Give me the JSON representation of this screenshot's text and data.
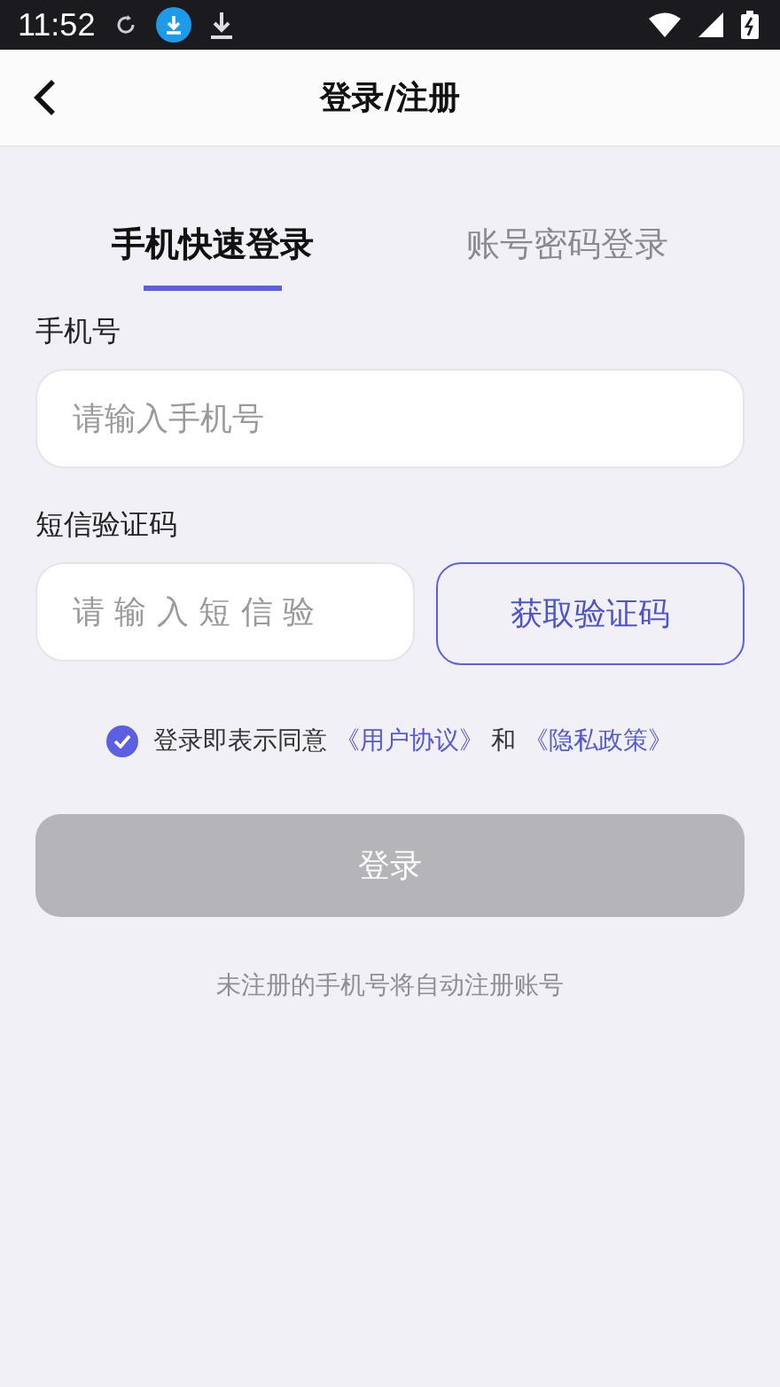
{
  "status_bar": {
    "time": "11:52"
  },
  "header": {
    "title": "登录/注册"
  },
  "tabs": [
    {
      "label": "手机快速登录",
      "selected": true
    },
    {
      "label": "账号密码登录",
      "selected": false
    }
  ],
  "phone": {
    "label": "手机号",
    "placeholder": "请输入手机号"
  },
  "sms": {
    "label": "短信验证码",
    "placeholder": "请 输 入 短 信 验",
    "button": "获取验证码"
  },
  "agreement": {
    "checked": true,
    "text": "登录即表示同意",
    "link_1": "《用户协议》",
    "and": "和",
    "link_2": "《隐私政策》"
  },
  "login_button": {
    "label": "登录",
    "disabled": true
  },
  "note": "未注册的手机号将自动注册账号"
}
